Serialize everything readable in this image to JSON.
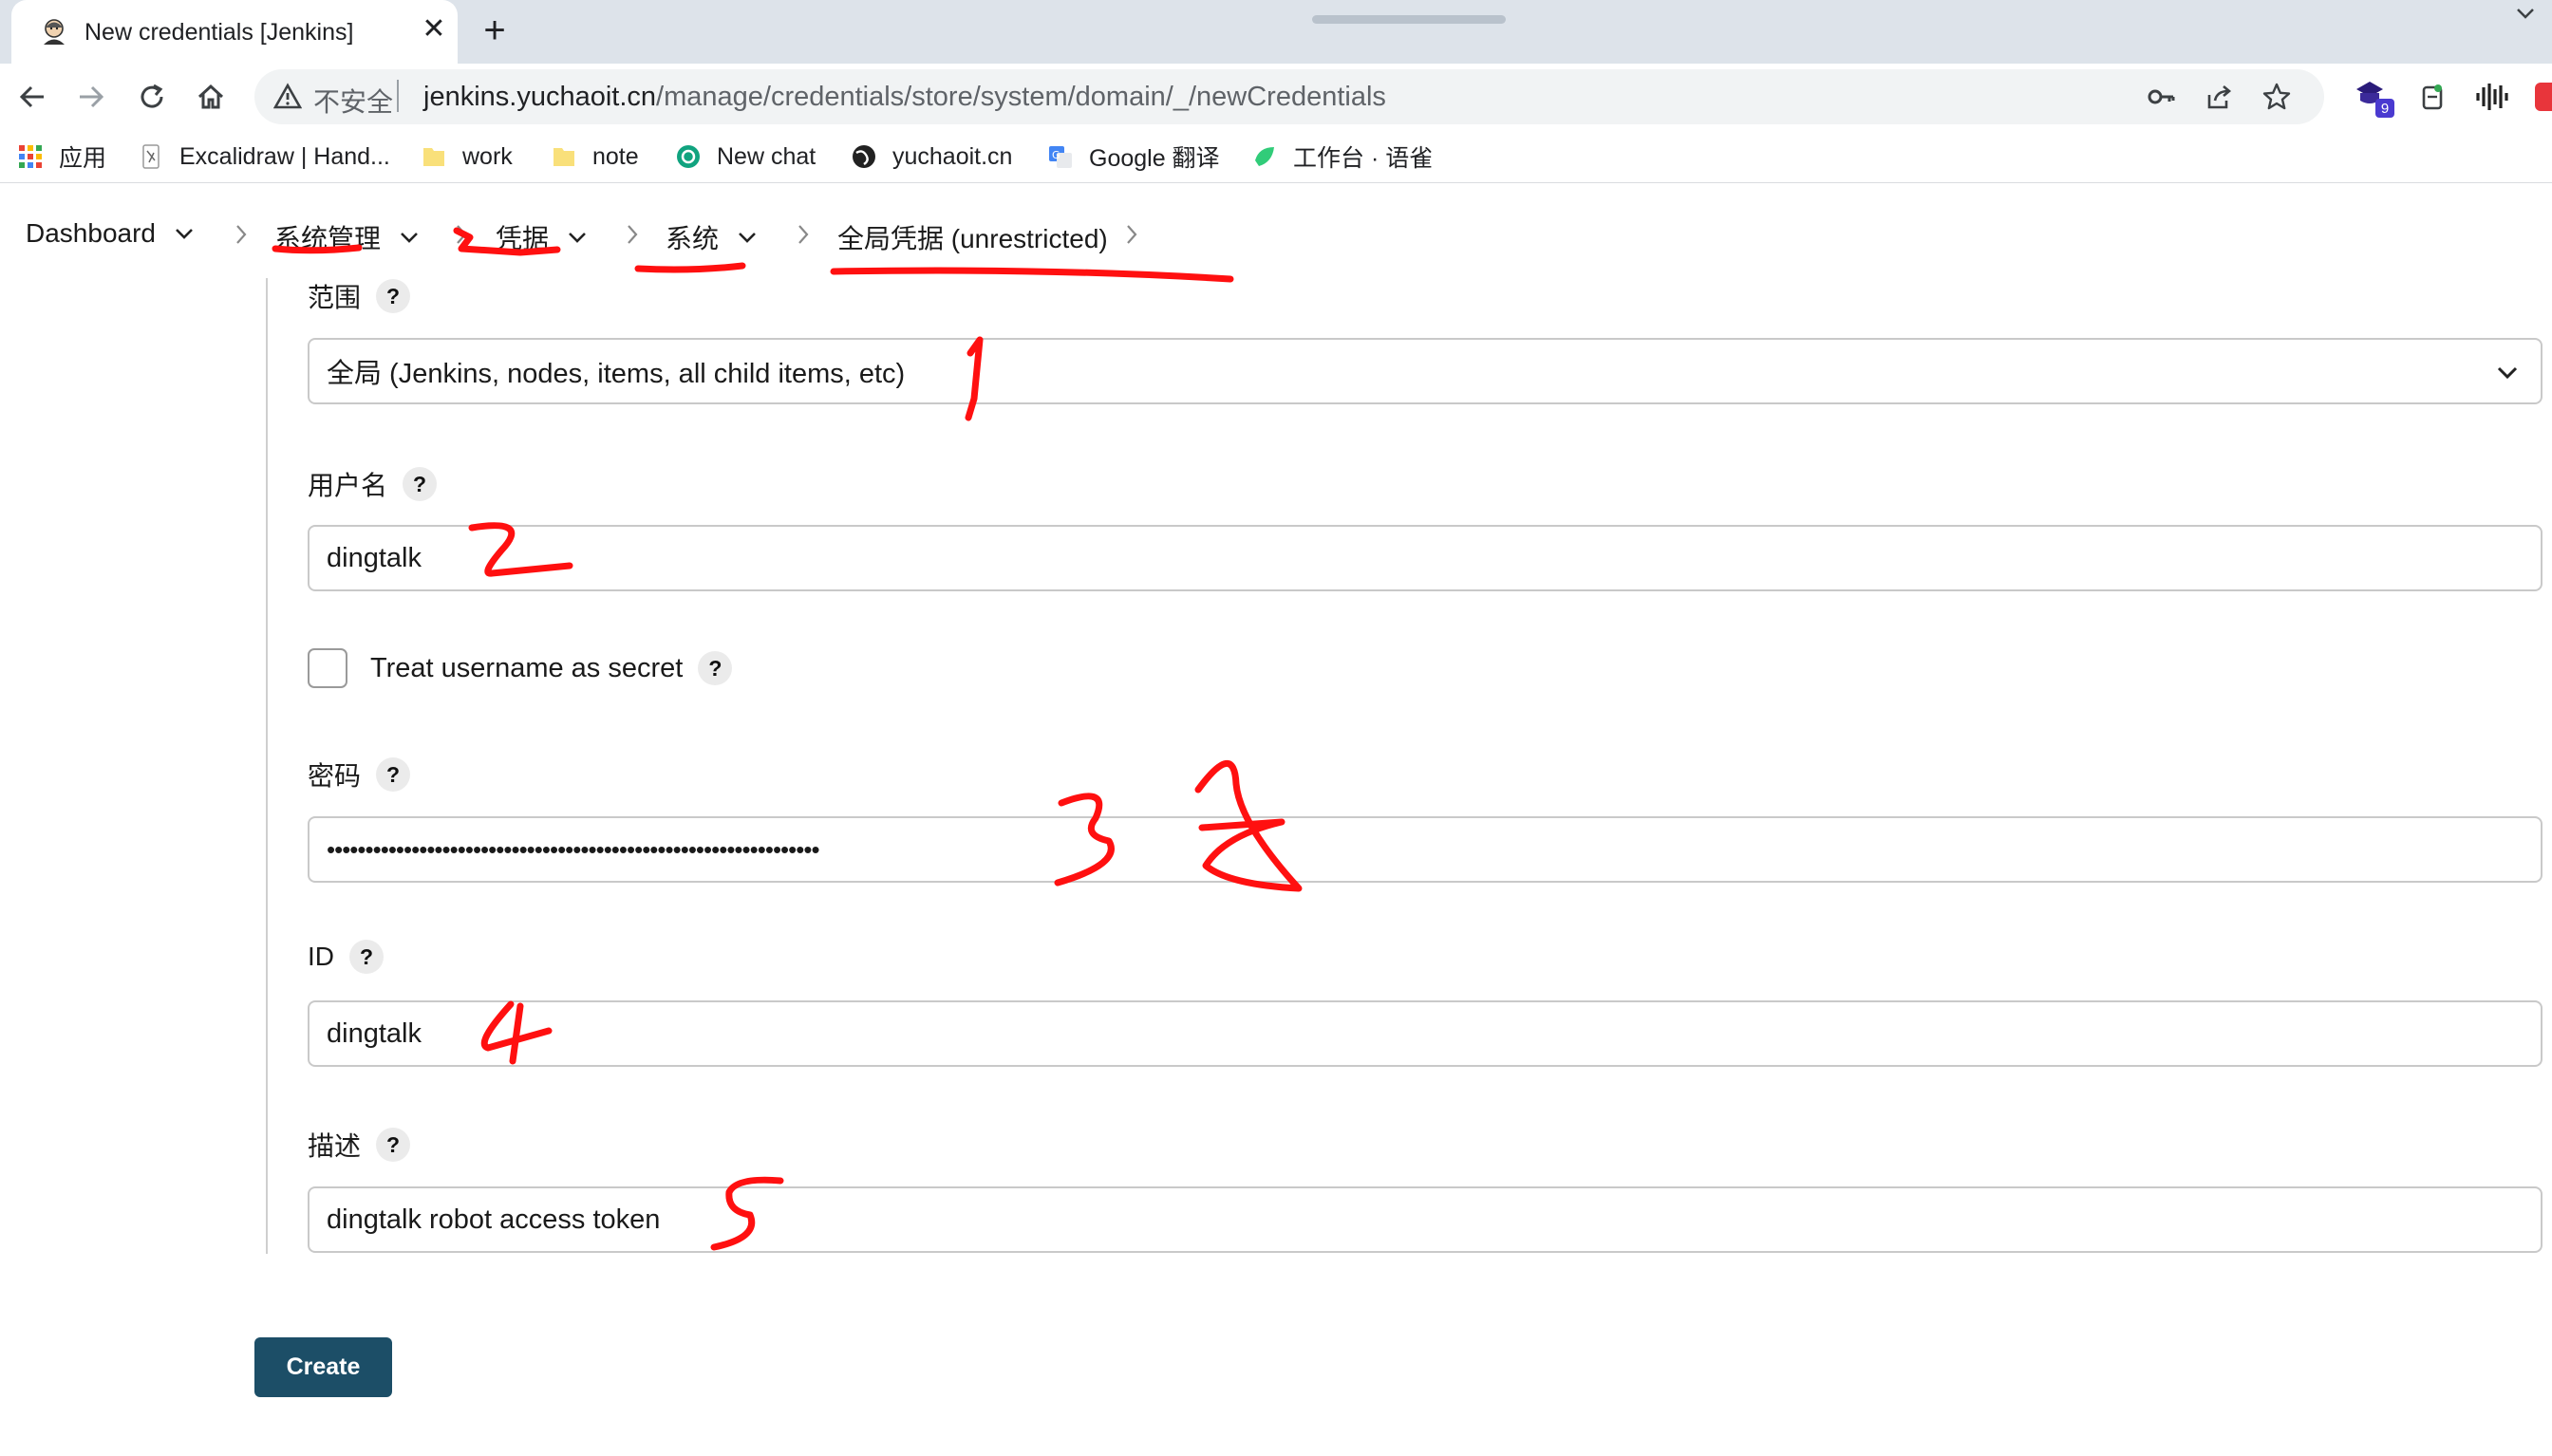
{
  "browser": {
    "tab_title": "New credentials [Jenkins]",
    "new_tab_symbol": "+",
    "close_symbol": "✕",
    "omnibox": {
      "security_label": "不安全",
      "url_host": "jenkins.yuchaoit.cn",
      "url_path": "/manage/credentials/store/system/domain/_/newCredentials"
    },
    "extension_badge": "9"
  },
  "bookmarks": [
    {
      "label": "应用",
      "icon": "apps-grid-icon"
    },
    {
      "label": "Excalidraw | Hand...",
      "icon": "excalidraw-icon"
    },
    {
      "label": "work",
      "icon": "folder-icon"
    },
    {
      "label": "note",
      "icon": "folder-icon"
    },
    {
      "label": "New chat",
      "icon": "chatgpt-icon"
    },
    {
      "label": "yuchaoit.cn",
      "icon": "globe-icon"
    },
    {
      "label": "Google 翻译",
      "icon": "google-translate-icon"
    },
    {
      "label": "工作台 · 语雀",
      "icon": "yuque-icon"
    }
  ],
  "breadcrumb": [
    {
      "label": "Dashboard"
    },
    {
      "label": "系统管理"
    },
    {
      "label": "凭据"
    },
    {
      "label": "系统"
    },
    {
      "label": "全局凭据 (unrestricted)"
    }
  ],
  "form": {
    "scope": {
      "label": "范围",
      "value": "全局 (Jenkins, nodes, items, all child items, etc)"
    },
    "username": {
      "label": "用户名",
      "value": "dingtalk"
    },
    "treat_secret": {
      "label": "Treat username as secret"
    },
    "password": {
      "label": "密码",
      "value": "••••••••••••••••••••••••••••••••••••••••••••••••••••••••••••••••"
    },
    "id": {
      "label": "ID",
      "value": "dingtalk"
    },
    "description": {
      "label": "描述",
      "value": "dingtalk robot access token"
    },
    "help_symbol": "?",
    "create_label": "Create"
  },
  "colors": {
    "tab_strip": "#dde3ea",
    "create_button": "#1c4e67",
    "annotation": "#ff0000"
  }
}
